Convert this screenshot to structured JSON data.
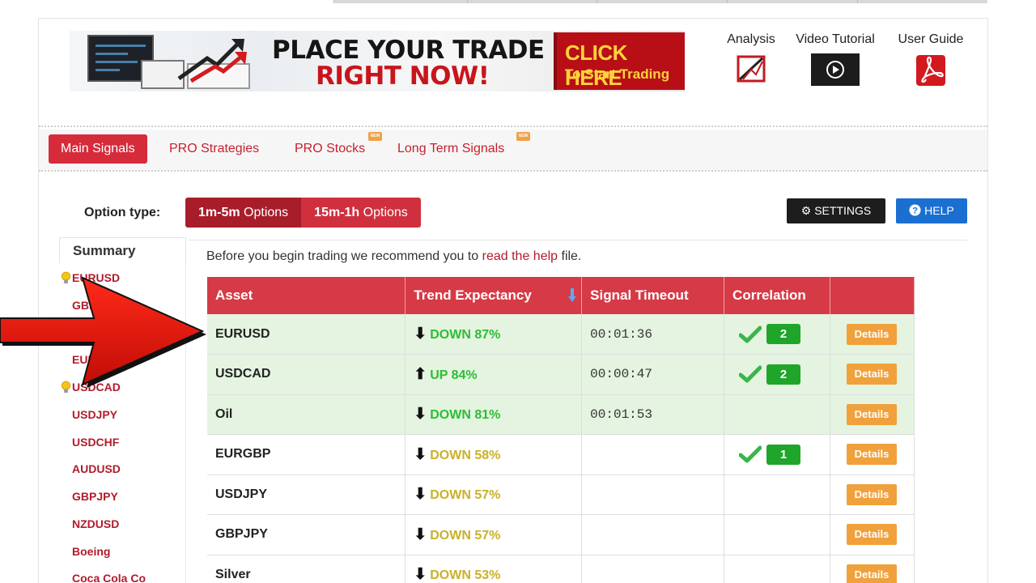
{
  "banner": {
    "headline_1": "PLACE YOUR TRADE",
    "headline_2": "RIGHT NOW!",
    "cta_1": "CLICK HERE",
    "cta_2": "To Start Trading"
  },
  "tools": [
    {
      "label": "Analysis",
      "icon": "analysis-icon"
    },
    {
      "label": "Video Tutorial",
      "icon": "play-icon"
    },
    {
      "label": "User Guide",
      "icon": "pdf-icon"
    }
  ],
  "nav": {
    "tabs": [
      {
        "label": "Main Signals",
        "active": true,
        "new": false
      },
      {
        "label": "PRO Strategies",
        "active": false,
        "new": false
      },
      {
        "label": "PRO Stocks",
        "active": false,
        "new": true
      },
      {
        "label": "Long Term Signals",
        "active": false,
        "new": true
      }
    ],
    "new_badge": "NEW"
  },
  "options": {
    "label": "Option type:",
    "btn1_bold": "1m-5m",
    "btn1_rest": " Options",
    "btn2_bold": "15m-1h",
    "btn2_rest": " Options",
    "settings": "SETTINGS",
    "help": "HELP"
  },
  "sidebar": {
    "title": "Summary",
    "items": [
      {
        "label": "EURUSD",
        "bulb": true
      },
      {
        "label": "GBP",
        "bulb": false
      },
      {
        "label": "EUR",
        "bulb": false
      },
      {
        "label": "USDCAD",
        "bulb": true
      },
      {
        "label": "USDJPY",
        "bulb": false
      },
      {
        "label": "USDCHF",
        "bulb": false
      },
      {
        "label": "AUDUSD",
        "bulb": false
      },
      {
        "label": "GBPJPY",
        "bulb": false
      },
      {
        "label": "NZDUSD",
        "bulb": false
      },
      {
        "label": "Boeing",
        "bulb": false
      },
      {
        "label": "Coca Cola Co",
        "bulb": false
      }
    ]
  },
  "intro": {
    "before": "Before you begin trading we recommend you to ",
    "link": "read the help",
    "after": " file."
  },
  "table": {
    "headers": [
      "Asset",
      "Trend Expectancy",
      "Signal Timeout",
      "Correlation",
      ""
    ],
    "details_label": "Details",
    "rows": [
      {
        "asset": "EURUSD",
        "dir": "down",
        "trend": "DOWN 87%",
        "timeout": "00:01:36",
        "corr": "2",
        "hot": true
      },
      {
        "asset": "USDCAD",
        "dir": "up",
        "trend": "UP 84%",
        "timeout": "00:00:47",
        "corr": "2",
        "hot": true
      },
      {
        "asset": "Oil",
        "dir": "down",
        "trend": "DOWN 81%",
        "timeout": "00:01:53",
        "corr": "",
        "hot": true
      },
      {
        "asset": "EURGBP",
        "dir": "down",
        "trend": "DOWN 58%",
        "timeout": "",
        "corr": "1",
        "hot": false
      },
      {
        "asset": "USDJPY",
        "dir": "down",
        "trend": "DOWN 57%",
        "timeout": "",
        "corr": "",
        "hot": false
      },
      {
        "asset": "GBPJPY",
        "dir": "down",
        "trend": "DOWN 57%",
        "timeout": "",
        "corr": "",
        "hot": false
      },
      {
        "asset": "Silver",
        "dir": "down",
        "trend": "DOWN 53%",
        "timeout": "",
        "corr": "",
        "hot": false
      }
    ]
  },
  "colors": {
    "accent": "#d62b3b",
    "hot_row": "#e4f4e0",
    "trend_hot": "#2cbd34",
    "trend_cold": "#c9b02a",
    "details": "#f0a13c"
  }
}
